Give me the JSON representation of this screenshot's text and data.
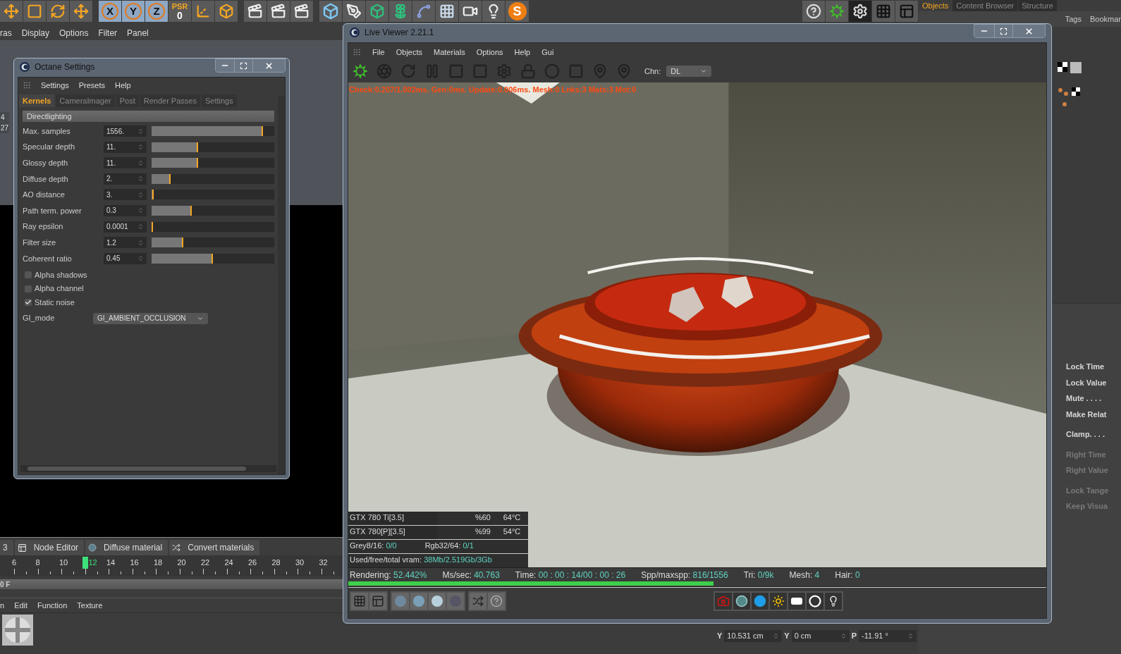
{
  "toolbar": {
    "axis_buttons": [
      "X",
      "Y",
      "Z"
    ],
    "psr_label": "PSR",
    "psr_value": "0",
    "logo_letter": "S"
  },
  "right_panel": {
    "tabs": [
      {
        "label": "Objects",
        "selected": true
      },
      {
        "label": "Content Browser",
        "selected": false
      },
      {
        "label": "Structure",
        "selected": false
      }
    ],
    "menu": [
      "Tags",
      "Bookmar"
    ],
    "properties": [
      {
        "label": "Lock Time",
        "disabled": false
      },
      {
        "label": "Lock Value",
        "disabled": false
      },
      {
        "label": "Mute . . . .",
        "disabled": false
      },
      {
        "label": "Make Relat",
        "disabled": false
      },
      {
        "label": "Clamp. . . .",
        "disabled": false
      },
      {
        "label": "Right Time",
        "disabled": true
      },
      {
        "label": "Right Value",
        "disabled": true
      },
      {
        "label": "Lock Tange",
        "disabled": true
      },
      {
        "label": "Keep Visua",
        "disabled": true
      }
    ]
  },
  "viewport": {
    "menu": [
      "ras",
      "Display",
      "Options",
      "Filter",
      "Panel"
    ],
    "hud": [
      "4",
      "27"
    ]
  },
  "octane_settings": {
    "title": "Octane Settings",
    "menu": [
      "Settings",
      "Presets",
      "Help"
    ],
    "tabs": [
      {
        "label": "Kernels",
        "selected": true
      },
      {
        "label": "CameraImager",
        "selected": false
      },
      {
        "label": "Post",
        "selected": false
      },
      {
        "label": "Render Passes",
        "selected": false
      },
      {
        "label": "Settings",
        "selected": false
      }
    ],
    "section": "Directlighting",
    "rows": [
      {
        "label": "Max. samples",
        "value": "1556.",
        "level": 0.91
      },
      {
        "label": "Specular depth",
        "value": "11.",
        "level": 0.38
      },
      {
        "label": "Glossy depth",
        "value": "11.",
        "level": 0.38
      },
      {
        "label": "Diffuse depth",
        "value": "2.",
        "level": 0.155
      },
      {
        "label": "AO distance",
        "value": "3.",
        "level": 0.02
      },
      {
        "label": "Path term. power",
        "value": "0.3",
        "level": 0.33
      },
      {
        "label": "Ray epsilon",
        "value": "0.0001",
        "level": 0.0
      },
      {
        "label": "Filter size",
        "value": "1.2",
        "level": 0.26
      },
      {
        "label": "Coherent ratio",
        "value": "0.45",
        "level": 0.5
      }
    ],
    "checkboxes": [
      {
        "label": "Alpha shadows",
        "checked": false
      },
      {
        "label": "Alpha channel",
        "checked": false
      },
      {
        "label": "Static noise",
        "checked": true
      }
    ],
    "gi_mode": {
      "label": "GI_mode",
      "value": "GI_AMBIENT_OCCLUSION"
    }
  },
  "live_viewer": {
    "title": "Live Viewer 2.21.1",
    "menu": [
      "File",
      "Objects",
      "Materials",
      "Options",
      "Help",
      "Gui"
    ],
    "channel": {
      "label": "Chn:",
      "value": "DL"
    },
    "status_text": "Check:0.207/1.002ms. Gen:0ms. Update:0.006ms. Mesh:0 Lnks:3 Mats:3 Mot:0",
    "gpus": [
      {
        "name": "GTX 780 Ti[3.5]",
        "load": "%60",
        "temp": "64°C"
      },
      {
        "name": "GTX 780[P][3.5]",
        "load": "%99",
        "temp": "54°C"
      }
    ],
    "textures": [
      {
        "label": "Grey8/16:",
        "value": "0/0"
      },
      {
        "label": "Rgb32/64:",
        "value": "0/1"
      }
    ],
    "vram": {
      "label": "Used/free/total vram:",
      "value": "38Mb/2.519Gb/3Gb"
    },
    "stats": [
      {
        "label": "Rendering:",
        "value": "52.442%"
      },
      {
        "label": "Ms/sec:",
        "value": "40.763"
      },
      {
        "label": "Time:",
        "value": "00 : 00 : 14/00 : 00 : 26"
      },
      {
        "label": "Spp/maxspp:",
        "value": "816/1556"
      },
      {
        "label": "Tri:",
        "value": "0/9k"
      },
      {
        "label": "Mesh:",
        "value": "4"
      },
      {
        "label": "Hair:",
        "value": "0"
      }
    ],
    "progress": {
      "level": 0.523
    }
  },
  "timeline": {
    "tabs": [
      "3",
      "Node Editor",
      "Diffuse material",
      "Convert materials"
    ],
    "ticks": [
      {
        "label": "6",
        "selected": false
      },
      {
        "label": "8",
        "selected": false
      },
      {
        "label": "10",
        "selected": false
      },
      {
        "label": "12",
        "selected": true
      },
      {
        "label": "14",
        "selected": false
      },
      {
        "label": "16",
        "selected": false
      },
      {
        "label": "18",
        "selected": false
      },
      {
        "label": "20",
        "selected": false
      },
      {
        "label": "22",
        "selected": false
      },
      {
        "label": "24",
        "selected": false
      },
      {
        "label": "26",
        "selected": false
      },
      {
        "label": "28",
        "selected": false
      },
      {
        "label": "30",
        "selected": false
      },
      {
        "label": "32",
        "selected": false
      }
    ],
    "frame_label": "0 F"
  },
  "material_manager": {
    "menu": [
      "n",
      "Edit",
      "Function",
      "Texture"
    ]
  },
  "coordinates": [
    {
      "axis": "Y",
      "value": "10.531 cm"
    },
    {
      "axis": "Y",
      "value": "0 cm"
    },
    {
      "axis": "P",
      "value": "-11.91 °"
    }
  ]
}
